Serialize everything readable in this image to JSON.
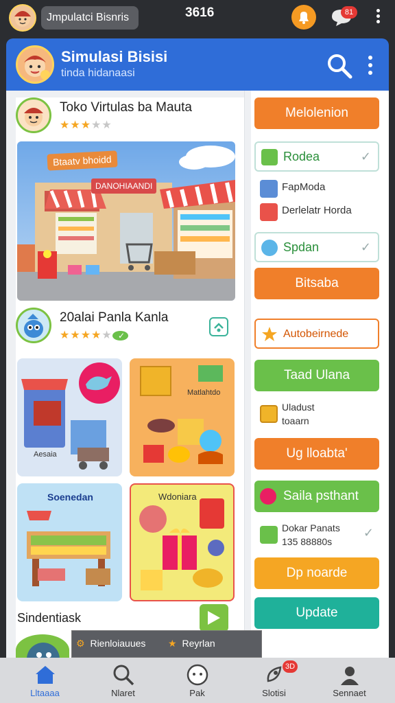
{
  "status_bar": {
    "pill_text": "Jmpulatci Bisnris",
    "time": "3616",
    "badge": "81",
    "icons": [
      "profile-avatar-icon",
      "bell-icon",
      "chat-icon",
      "more-vertical-icon"
    ]
  },
  "app_bar": {
    "title": "Simulasi Bisisi",
    "subtitle": "tinda hidanaasi",
    "icons": [
      "search-icon",
      "more-vertical-icon"
    ]
  },
  "store_card": {
    "title": "Toko Virtulas ba Mauta",
    "rating": 3,
    "rating_max": 5,
    "hero_tag": "Btaatv bhoidd",
    "hero_sign": "DANOHIAANDI"
  },
  "product_card": {
    "title": "20alai Panla Kanla",
    "rating": 4,
    "rating_max": 5,
    "check": "✓"
  },
  "tiles": [
    {
      "label": "Aesaia"
    },
    {
      "label": "Matlahtdo"
    },
    {
      "label": "Soenedan"
    },
    {
      "label": "Wdoniara"
    }
  ],
  "section": {
    "label": "Sindentiask"
  },
  "toast": {
    "left_text": "Rienloiauues",
    "right_text": "Reyrlan"
  },
  "right_panel": {
    "btn1": "Melolenion",
    "opt1": "Rodea",
    "item1": "FapModa",
    "item2": "Derlelatr Horda",
    "opt2": "Spdan",
    "btn2": "Bitsaba",
    "opt3": "Autobeirnede",
    "btn3": "Taad Ulana",
    "item3_line1": "Uladust",
    "item3_line2": "toaarn",
    "btn4": "Ug lloabta'",
    "btn5": "Saila psthant",
    "item4_line1": "Dokar Panats",
    "item4_line2": "135 88880s",
    "btn6": "Dp noarde",
    "btn7": "Update",
    "check": "✓"
  },
  "bottom_nav": {
    "items": [
      "Lltaaaa",
      "Nlaret",
      "Pak",
      "Slotisi",
      "Sennaet"
    ],
    "badge": "3D"
  },
  "colors": {
    "orange": "#f07f2a",
    "green": "#6ac04a",
    "teal": "#1fb19a",
    "blue": "#2f6dd8",
    "yellow_orange": "#f5a623"
  }
}
